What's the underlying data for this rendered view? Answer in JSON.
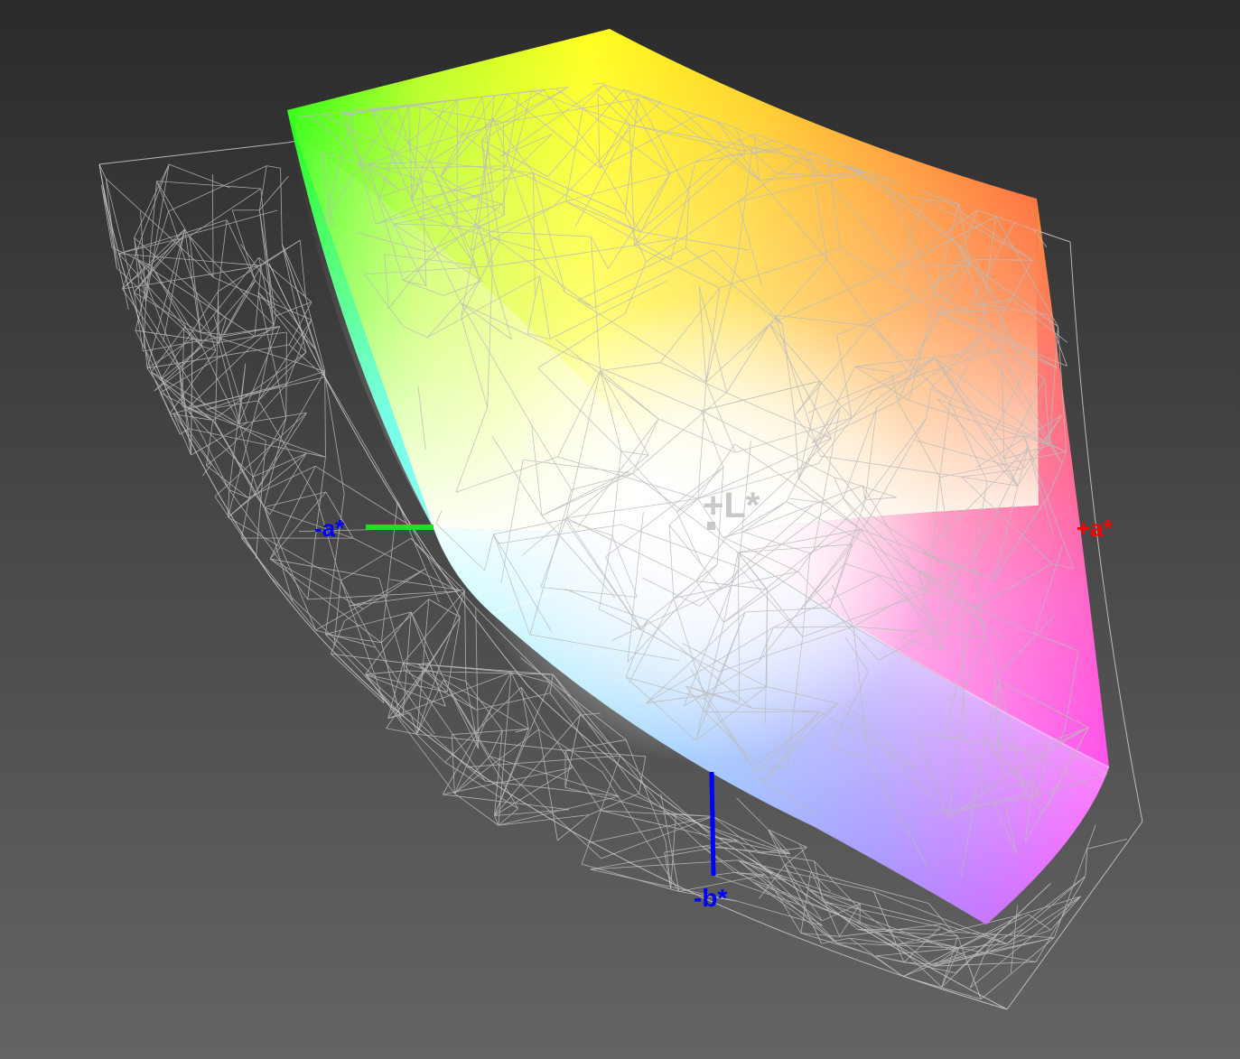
{
  "labels": {
    "plus_l": "+L*",
    "plus_a": "+a*",
    "minus_a": "-a*",
    "minus_b": "-b*"
  },
  "colors": {
    "plus_a": "#ff0000",
    "minus_a": "#0000ff",
    "minus_b": "#0000ff",
    "plus_l": "#c8c8c8",
    "green_axis": "#22dd22",
    "blue_axis": "#0000ff",
    "wireframe": "#d0d0d0"
  }
}
